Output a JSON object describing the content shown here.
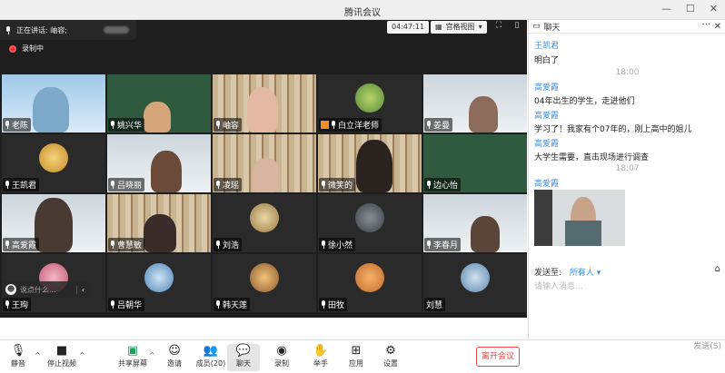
{
  "window": {
    "title": "腾讯会议"
  },
  "meeting": {
    "speaking_label": "正在讲话: 岫容;",
    "recording_label": "录制中",
    "timer": "04:47:11",
    "view_mode": "宫格视图"
  },
  "participants": [
    "老陈",
    "姚兴华",
    "岫容",
    "白立洋老师",
    "姜曼",
    "王凯君",
    "吕晓丽",
    "凌瑶",
    "微笑的",
    "边心怡",
    "高爱霞",
    "曹慧敏",
    "刘浩",
    "徐小然",
    "李春月",
    "王珣",
    "吕朝华",
    "韩天莲",
    "田牧",
    "刘慧"
  ],
  "overlay_chat": {
    "placeholder": "说点什么..."
  },
  "toolbar": {
    "mute": "静音",
    "stop_video": "停止视频",
    "share_screen": "共享屏幕",
    "invite": "邀请",
    "members": "成员(20)",
    "chat": "聊天",
    "record": "录制",
    "raise_hand": "举手",
    "apps": "应用",
    "settings": "设置",
    "leave": "离开会议"
  },
  "chat": {
    "title": "聊天",
    "messages": [
      {
        "sender": "王凯君",
        "text": "明白了"
      },
      {
        "time": "18:00"
      },
      {
        "sender": "高爱霞",
        "text": "04年出生的学生，走进他们"
      },
      {
        "sender": "高爱霞",
        "text": "学习了！我家有个07年的，刚上高中的姐儿"
      },
      {
        "sender": "高爱霞",
        "text": "大学生需要，直击现场进行调查"
      },
      {
        "time": "18:07"
      },
      {
        "sender": "高爱霞"
      }
    ],
    "send_to_label": "发送至:",
    "send_to_target": "所有人",
    "input_placeholder": "请输入消息...",
    "send_button": "发送(S)"
  },
  "colors": {
    "accent": "#3a8ee6",
    "leave": "#e44444",
    "recording": "#e33333"
  }
}
